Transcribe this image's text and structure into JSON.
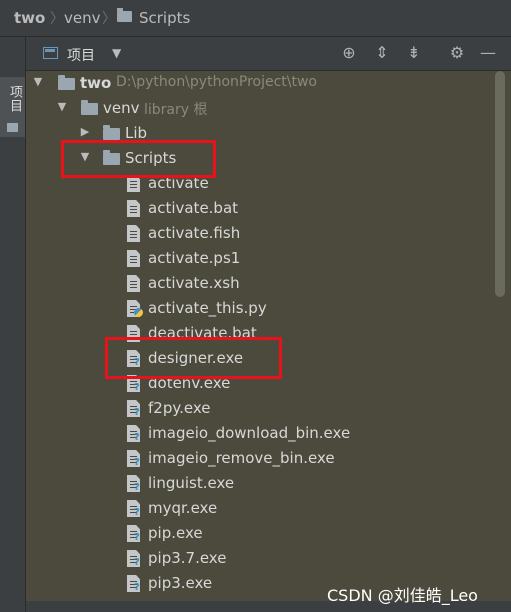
{
  "breadcrumb": {
    "root": "two",
    "venv": "venv",
    "scripts": "Scripts"
  },
  "sidebar": {
    "project_tab": "项目"
  },
  "toolbar": {
    "view_label": "项目",
    "icons": [
      "locate-icon",
      "expand-all-icon",
      "collapse-all-icon",
      "gear-icon",
      "minimize-icon"
    ]
  },
  "tree": {
    "root": {
      "name": "two",
      "path": "D:\\python\\pythonProject\\two"
    },
    "venv": {
      "name": "venv",
      "meta": "library 根"
    },
    "lib": {
      "name": "Lib"
    },
    "scripts": {
      "name": "Scripts"
    },
    "files": [
      {
        "name": "activate",
        "type": "text"
      },
      {
        "name": "activate.bat",
        "type": "text"
      },
      {
        "name": "activate.fish",
        "type": "text"
      },
      {
        "name": "activate.ps1",
        "type": "text"
      },
      {
        "name": "activate.xsh",
        "type": "text"
      },
      {
        "name": "activate_this.py",
        "type": "python"
      },
      {
        "name": "deactivate.bat",
        "type": "text"
      },
      {
        "name": "designer.exe",
        "type": "exe"
      },
      {
        "name": "dotenv.exe",
        "type": "exe"
      },
      {
        "name": "f2py.exe",
        "type": "exe"
      },
      {
        "name": "imageio_download_bin.exe",
        "type": "exe"
      },
      {
        "name": "imageio_remove_bin.exe",
        "type": "exe"
      },
      {
        "name": "linguist.exe",
        "type": "exe"
      },
      {
        "name": "myqr.exe",
        "type": "exe"
      },
      {
        "name": "pip.exe",
        "type": "exe"
      },
      {
        "name": "pip3.7.exe",
        "type": "exe"
      },
      {
        "name": "pip3.exe",
        "type": "exe"
      }
    ]
  },
  "colors": {
    "highlight": "#e8131a",
    "tree_bg": "#4b4a3d"
  },
  "watermark": "CSDN @刘佳皓_Leo"
}
